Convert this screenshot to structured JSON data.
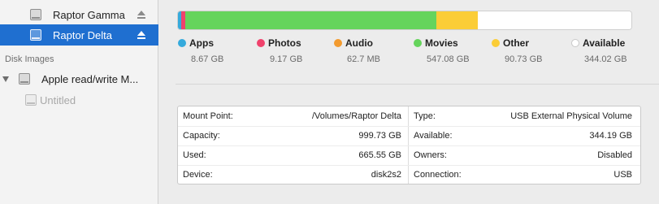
{
  "sidebar": {
    "devices": [
      {
        "label": "Raptor Gamma",
        "selected": false
      },
      {
        "label": "Raptor Delta",
        "selected": true
      }
    ],
    "disk_images_header": "Disk Images",
    "disk_images": [
      {
        "label": "Apple read/write M..."
      },
      {
        "label": "Untitled"
      }
    ]
  },
  "storage": {
    "categories": [
      {
        "name": "Apps",
        "size": "8.67 GB",
        "color": "#35aadc"
      },
      {
        "name": "Photos",
        "size": "9.17 GB",
        "color": "#f0426c"
      },
      {
        "name": "Audio",
        "size": "62.7 MB",
        "color": "#f39b2f"
      },
      {
        "name": "Movies",
        "size": "547.08 GB",
        "color": "#65d45c"
      },
      {
        "name": "Other",
        "size": "90.73 GB",
        "color": "#fbcd37"
      },
      {
        "name": "Available",
        "size": "344.02 GB",
        "color": "#ffffff"
      }
    ]
  },
  "info": {
    "left": [
      {
        "key": "Mount Point:",
        "value": "/Volumes/Raptor Delta"
      },
      {
        "key": "Capacity:",
        "value": "999.73 GB"
      },
      {
        "key": "Used:",
        "value": "665.55 GB"
      },
      {
        "key": "Device:",
        "value": "disk2s2"
      }
    ],
    "right": [
      {
        "key": "Type:",
        "value": "USB External Physical Volume"
      },
      {
        "key": "Available:",
        "value": "344.19 GB"
      },
      {
        "key": "Owners:",
        "value": "Disabled"
      },
      {
        "key": "Connection:",
        "value": "USB"
      }
    ]
  }
}
